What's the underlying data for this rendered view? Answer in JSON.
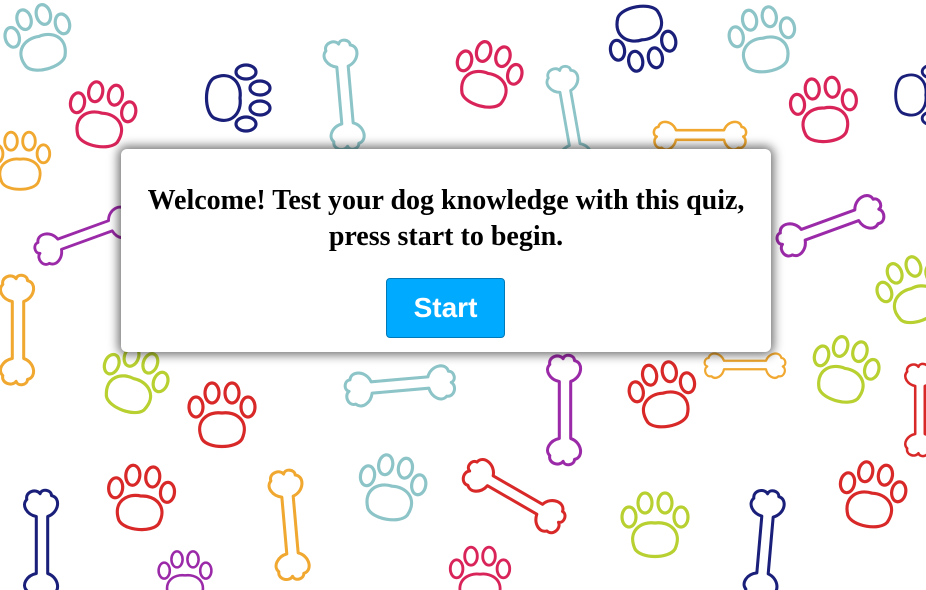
{
  "background": {
    "pattern_name": "paw-and-bone-pattern",
    "colors": {
      "teal": "#8cc4c8",
      "navy": "#1a1f7a",
      "pink": "#d9245a",
      "purple": "#9b2aa8",
      "orange": "#f0a830",
      "lime": "#b8d030",
      "red": "#d82828"
    }
  },
  "dialog": {
    "message": "Welcome! Test your dog knowledge with this quiz, press start to begin.",
    "start_label": "Start",
    "button_color": "#00aaff"
  }
}
